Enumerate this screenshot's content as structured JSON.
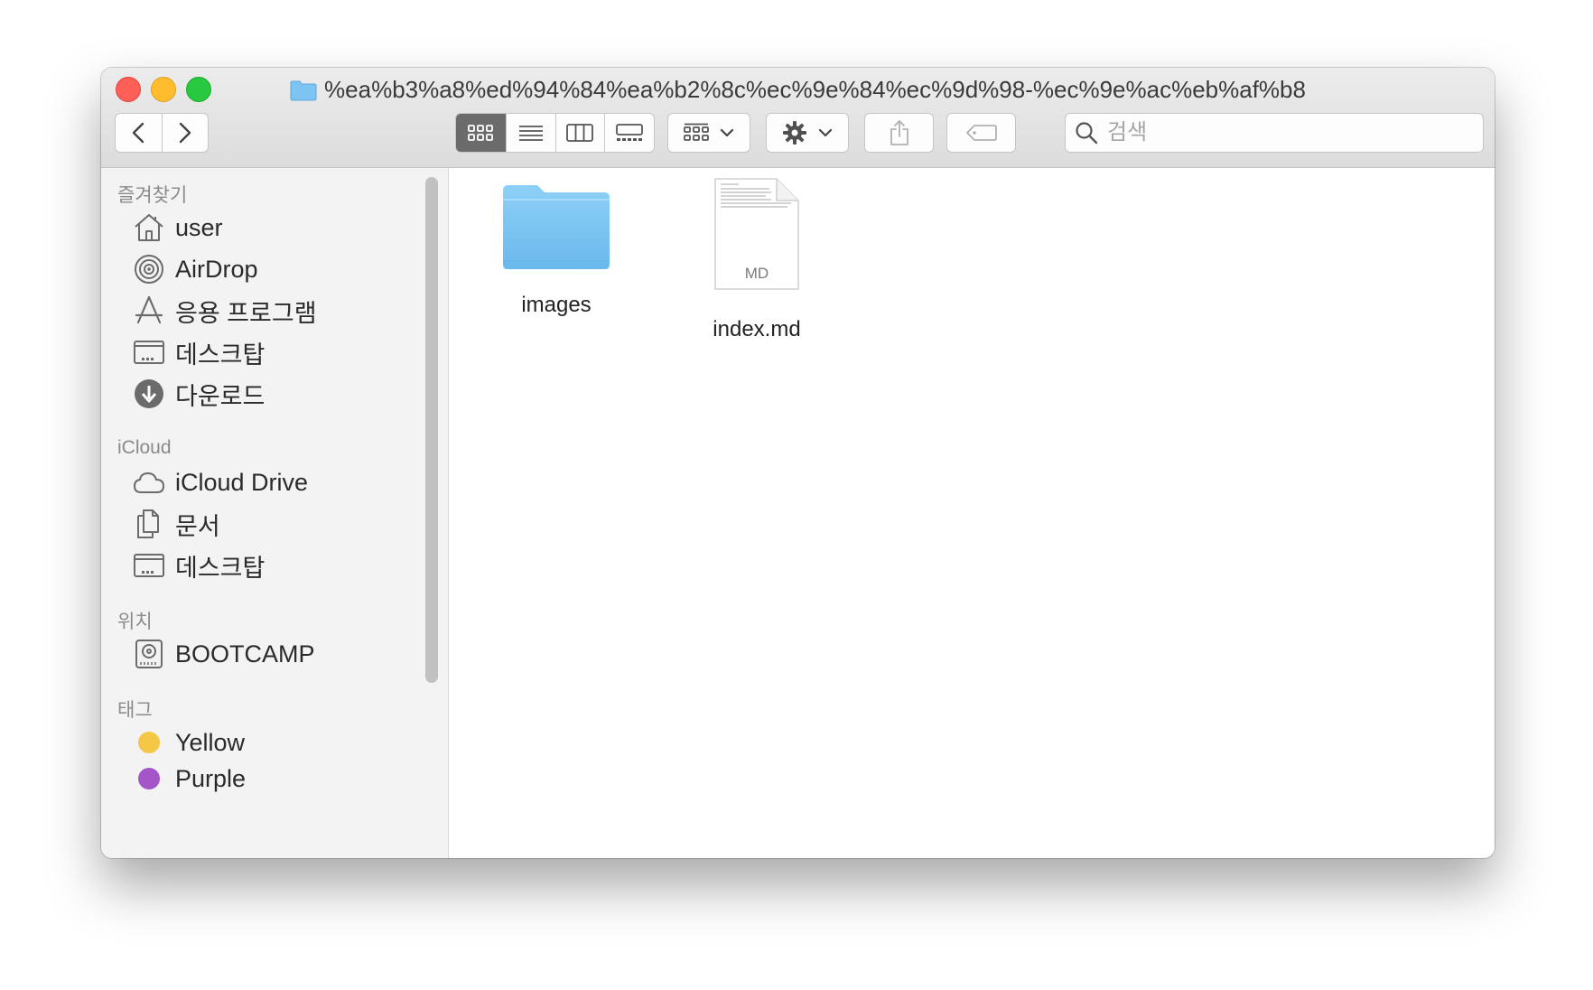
{
  "window": {
    "title": "%ea%b3%a8%ed%94%84%ea%b2%8c%ec%9e%84%ec%9d%98-%ec%9e%ac%eb%af%b8"
  },
  "toolbar": {
    "back_icon": "chevron-left-icon",
    "forward_icon": "chevron-right-icon",
    "views": [
      "icon-view",
      "list-view",
      "column-view",
      "gallery-view"
    ],
    "active_view": "icon-view",
    "search_placeholder": "검색"
  },
  "sidebar": {
    "favorites_title": "즐겨찾기",
    "favorites": [
      {
        "label": "user",
        "icon": "home-icon"
      },
      {
        "label": "AirDrop",
        "icon": "airdrop-icon"
      },
      {
        "label": "응용 프로그램",
        "icon": "applications-icon"
      },
      {
        "label": "데스크탑",
        "icon": "desktop-icon"
      },
      {
        "label": "다운로드",
        "icon": "download-icon"
      }
    ],
    "icloud_title": "iCloud",
    "icloud": [
      {
        "label": "iCloud Drive",
        "icon": "cloud-icon"
      },
      {
        "label": "문서",
        "icon": "documents-icon"
      },
      {
        "label": "데스크탑",
        "icon": "desktop-icon"
      }
    ],
    "locations_title": "위치",
    "locations": [
      {
        "label": "BOOTCAMP",
        "icon": "disk-icon"
      }
    ],
    "tags_title": "태그",
    "tags": [
      {
        "label": "Yellow",
        "color": "#f5c747"
      },
      {
        "label": "Purple",
        "color": "#a455c8"
      }
    ]
  },
  "files": [
    {
      "name": "images",
      "type": "folder"
    },
    {
      "name": "index.md",
      "type": "markdown",
      "badge": "MD"
    }
  ],
  "colors": {
    "folder": "#7cc4f2",
    "close": "#fe5f57",
    "minimize": "#febc2e",
    "maximize": "#28c840"
  }
}
